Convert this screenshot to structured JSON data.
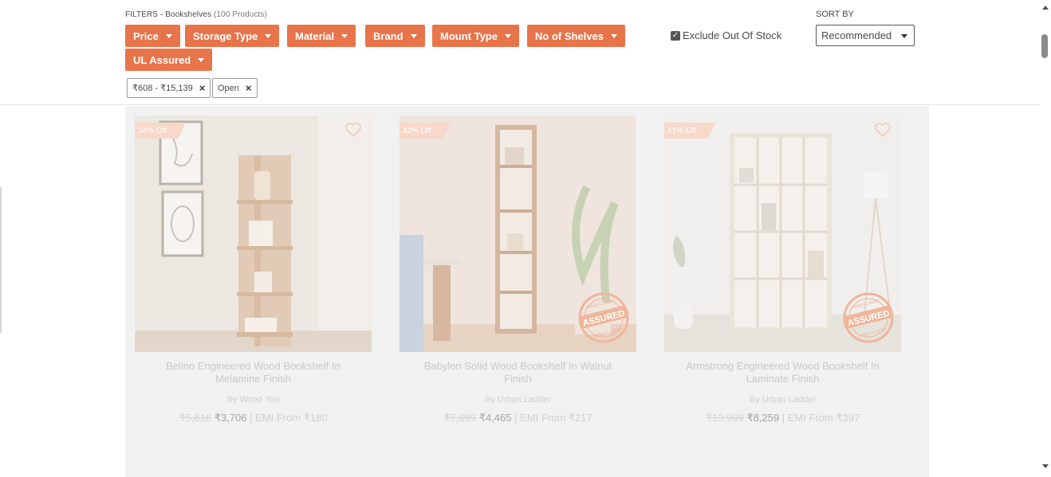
{
  "filters": {
    "prefix": "FILTERS - ",
    "category": "Bookshelves",
    "count": "(100 Products)",
    "buttons": [
      {
        "label": "Price"
      },
      {
        "label": "Storage Type"
      },
      {
        "label": "Material"
      },
      {
        "label": "Brand"
      },
      {
        "label": "Mount Type"
      },
      {
        "label": "No of Shelves"
      },
      {
        "label": "UL Assured"
      }
    ],
    "chips": [
      {
        "label": "₹608 - ₹15,139"
      },
      {
        "label": "Open"
      }
    ],
    "exclude_label": "Exclude Out Of Stock",
    "exclude_checked": true
  },
  "sort": {
    "label": "SORT BY",
    "value": "Recommended"
  },
  "colors": {
    "accent": "#e8744a",
    "overlay_gray": "#f1f1f1"
  },
  "products": [
    {
      "discount": "34% Off",
      "title": "Belino Engineered Wood Bookshelf In Melamine Finish",
      "brand": "By Wood You",
      "mrp": "₹5,616",
      "price": "₹3,706",
      "emi": " | EMI From ₹180",
      "assured": false
    },
    {
      "discount": "42% Off",
      "title": "Babylon Solid Wood Bookshelf In Walnut Finish",
      "brand": "By Urban Ladder",
      "mrp": "₹7,699",
      "price": "₹4,465",
      "emi": " | EMI From ₹217",
      "assured": true
    },
    {
      "discount": "41% Off",
      "title": "Armstrong Engineered Wood Bookshelf In Laminate Finish",
      "brand": "By Urban Ladder",
      "mrp": "₹13,999",
      "price": "₹8,259",
      "emi": " | EMI From ₹397",
      "assured": true
    }
  ],
  "badge": {
    "top": "Urban Ladder",
    "middle": "ASSURED",
    "bottom": "Urban Ladder"
  }
}
